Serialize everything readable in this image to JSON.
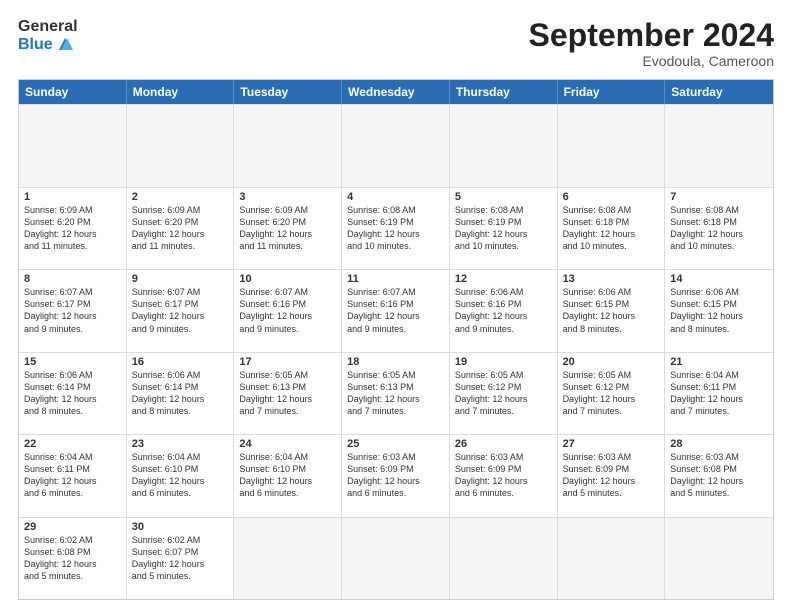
{
  "header": {
    "logo_general": "General",
    "logo_blue": "Blue",
    "month": "September 2024",
    "location": "Evodoula, Cameroon"
  },
  "weekdays": [
    "Sunday",
    "Monday",
    "Tuesday",
    "Wednesday",
    "Thursday",
    "Friday",
    "Saturday"
  ],
  "rows": [
    [
      null,
      null,
      null,
      null,
      null,
      null,
      null
    ]
  ],
  "cells": [
    [
      {
        "day": null
      },
      {
        "day": null
      },
      {
        "day": null
      },
      {
        "day": null
      },
      {
        "day": null
      },
      {
        "day": null
      },
      {
        "day": null
      }
    ],
    [
      {
        "day": "1",
        "lines": [
          "Sunrise: 6:09 AM",
          "Sunset: 6:20 PM",
          "Daylight: 12 hours",
          "and 11 minutes."
        ]
      },
      {
        "day": "2",
        "lines": [
          "Sunrise: 6:09 AM",
          "Sunset: 6:20 PM",
          "Daylight: 12 hours",
          "and 11 minutes."
        ]
      },
      {
        "day": "3",
        "lines": [
          "Sunrise: 6:09 AM",
          "Sunset: 6:20 PM",
          "Daylight: 12 hours",
          "and 11 minutes."
        ]
      },
      {
        "day": "4",
        "lines": [
          "Sunrise: 6:08 AM",
          "Sunset: 6:19 PM",
          "Daylight: 12 hours",
          "and 10 minutes."
        ]
      },
      {
        "day": "5",
        "lines": [
          "Sunrise: 6:08 AM",
          "Sunset: 6:19 PM",
          "Daylight: 12 hours",
          "and 10 minutes."
        ]
      },
      {
        "day": "6",
        "lines": [
          "Sunrise: 6:08 AM",
          "Sunset: 6:18 PM",
          "Daylight: 12 hours",
          "and 10 minutes."
        ]
      },
      {
        "day": "7",
        "lines": [
          "Sunrise: 6:08 AM",
          "Sunset: 6:18 PM",
          "Daylight: 12 hours",
          "and 10 minutes."
        ]
      }
    ],
    [
      {
        "day": "8",
        "lines": [
          "Sunrise: 6:07 AM",
          "Sunset: 6:17 PM",
          "Daylight: 12 hours",
          "and 9 minutes."
        ]
      },
      {
        "day": "9",
        "lines": [
          "Sunrise: 6:07 AM",
          "Sunset: 6:17 PM",
          "Daylight: 12 hours",
          "and 9 minutes."
        ]
      },
      {
        "day": "10",
        "lines": [
          "Sunrise: 6:07 AM",
          "Sunset: 6:16 PM",
          "Daylight: 12 hours",
          "and 9 minutes."
        ]
      },
      {
        "day": "11",
        "lines": [
          "Sunrise: 6:07 AM",
          "Sunset: 6:16 PM",
          "Daylight: 12 hours",
          "and 9 minutes."
        ]
      },
      {
        "day": "12",
        "lines": [
          "Sunrise: 6:06 AM",
          "Sunset: 6:16 PM",
          "Daylight: 12 hours",
          "and 9 minutes."
        ]
      },
      {
        "day": "13",
        "lines": [
          "Sunrise: 6:06 AM",
          "Sunset: 6:15 PM",
          "Daylight: 12 hours",
          "and 8 minutes."
        ]
      },
      {
        "day": "14",
        "lines": [
          "Sunrise: 6:06 AM",
          "Sunset: 6:15 PM",
          "Daylight: 12 hours",
          "and 8 minutes."
        ]
      }
    ],
    [
      {
        "day": "15",
        "lines": [
          "Sunrise: 6:06 AM",
          "Sunset: 6:14 PM",
          "Daylight: 12 hours",
          "and 8 minutes."
        ]
      },
      {
        "day": "16",
        "lines": [
          "Sunrise: 6:06 AM",
          "Sunset: 6:14 PM",
          "Daylight: 12 hours",
          "and 8 minutes."
        ]
      },
      {
        "day": "17",
        "lines": [
          "Sunrise: 6:05 AM",
          "Sunset: 6:13 PM",
          "Daylight: 12 hours",
          "and 7 minutes."
        ]
      },
      {
        "day": "18",
        "lines": [
          "Sunrise: 6:05 AM",
          "Sunset: 6:13 PM",
          "Daylight: 12 hours",
          "and 7 minutes."
        ]
      },
      {
        "day": "19",
        "lines": [
          "Sunrise: 6:05 AM",
          "Sunset: 6:12 PM",
          "Daylight: 12 hours",
          "and 7 minutes."
        ]
      },
      {
        "day": "20",
        "lines": [
          "Sunrise: 6:05 AM",
          "Sunset: 6:12 PM",
          "Daylight: 12 hours",
          "and 7 minutes."
        ]
      },
      {
        "day": "21",
        "lines": [
          "Sunrise: 6:04 AM",
          "Sunset: 6:11 PM",
          "Daylight: 12 hours",
          "and 7 minutes."
        ]
      }
    ],
    [
      {
        "day": "22",
        "lines": [
          "Sunrise: 6:04 AM",
          "Sunset: 6:11 PM",
          "Daylight: 12 hours",
          "and 6 minutes."
        ]
      },
      {
        "day": "23",
        "lines": [
          "Sunrise: 6:04 AM",
          "Sunset: 6:10 PM",
          "Daylight: 12 hours",
          "and 6 minutes."
        ]
      },
      {
        "day": "24",
        "lines": [
          "Sunrise: 6:04 AM",
          "Sunset: 6:10 PM",
          "Daylight: 12 hours",
          "and 6 minutes."
        ]
      },
      {
        "day": "25",
        "lines": [
          "Sunrise: 6:03 AM",
          "Sunset: 6:09 PM",
          "Daylight: 12 hours",
          "and 6 minutes."
        ]
      },
      {
        "day": "26",
        "lines": [
          "Sunrise: 6:03 AM",
          "Sunset: 6:09 PM",
          "Daylight: 12 hours",
          "and 6 minutes."
        ]
      },
      {
        "day": "27",
        "lines": [
          "Sunrise: 6:03 AM",
          "Sunset: 6:09 PM",
          "Daylight: 12 hours",
          "and 5 minutes."
        ]
      },
      {
        "day": "28",
        "lines": [
          "Sunrise: 6:03 AM",
          "Sunset: 6:08 PM",
          "Daylight: 12 hours",
          "and 5 minutes."
        ]
      }
    ],
    [
      {
        "day": "29",
        "lines": [
          "Sunrise: 6:02 AM",
          "Sunset: 6:08 PM",
          "Daylight: 12 hours",
          "and 5 minutes."
        ]
      },
      {
        "day": "30",
        "lines": [
          "Sunrise: 6:02 AM",
          "Sunset: 6:07 PM",
          "Daylight: 12 hours",
          "and 5 minutes."
        ]
      },
      {
        "day": null
      },
      {
        "day": null
      },
      {
        "day": null
      },
      {
        "day": null
      },
      {
        "day": null
      }
    ]
  ]
}
